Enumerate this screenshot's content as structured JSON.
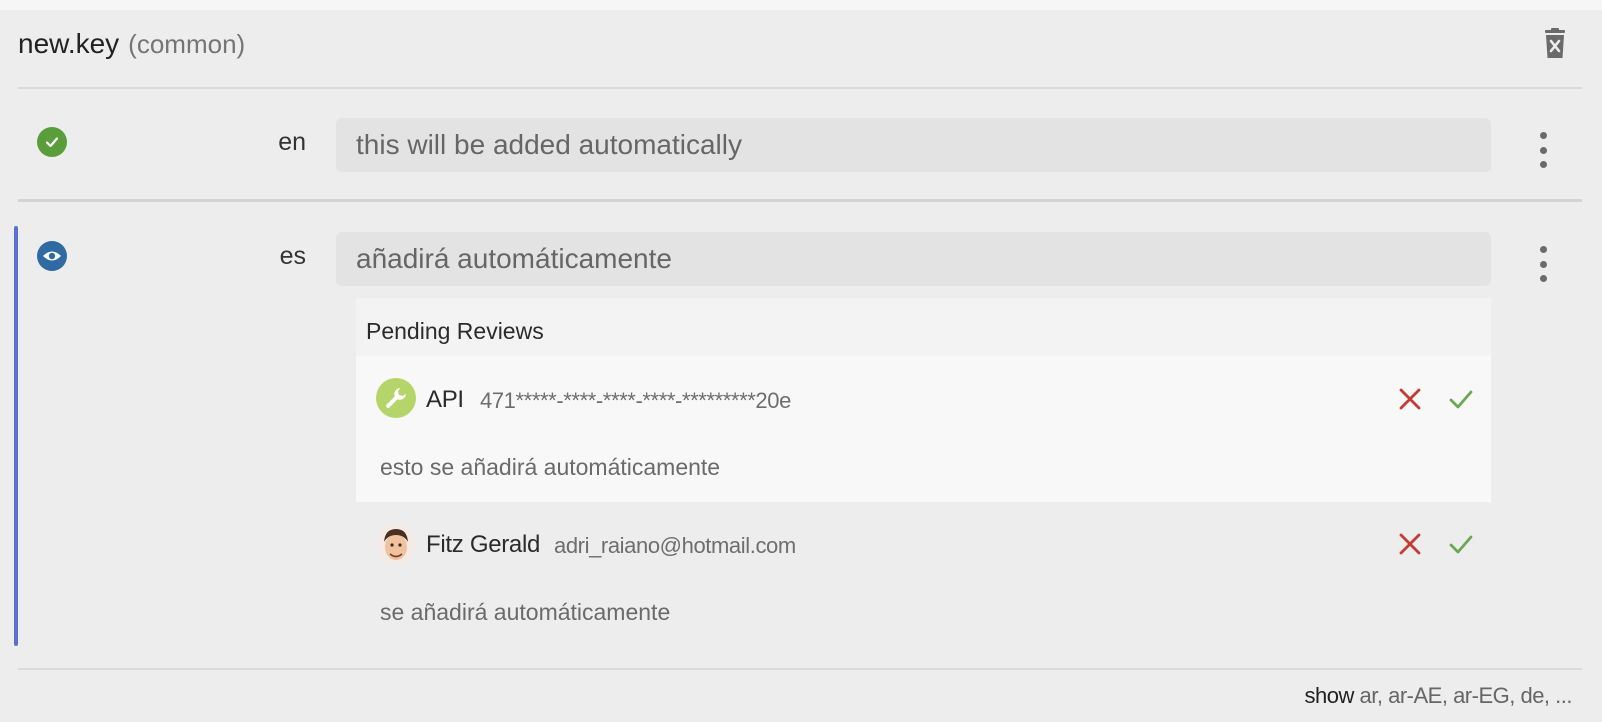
{
  "key": {
    "name": "new.key",
    "namespace": "(common)"
  },
  "icons": {
    "delete": "trash-x-icon",
    "translated": "check-circle-icon",
    "review": "eye-circle-icon",
    "more": "more-vert-icon"
  },
  "colors": {
    "accent": "#5b6fd4",
    "ok": "#5a9e3b",
    "review": "#2f6aa3",
    "reject": "#c53a33",
    "approve": "#6aa84f"
  },
  "translations": [
    {
      "lang": "en",
      "status": "translated",
      "value": "this will be added automatically"
    },
    {
      "lang": "es",
      "status": "in-review",
      "value": "añadirá automáticamente"
    }
  ],
  "pending_reviews": {
    "title": "Pending Reviews",
    "items": [
      {
        "author": "API",
        "author_detail": "471*****-****-****-****-*********20e",
        "text": "esto se añadirá automáticamente",
        "avatar": "wrench-icon"
      },
      {
        "author": "Fitz Gerald",
        "author_detail": "adri_raiano@hotmail.com",
        "text": "se añadirá automáticamente",
        "avatar": "user-avatar"
      }
    ]
  },
  "show_more": {
    "label": "show",
    "languages": "ar, ar-AE, ar-EG, de, ..."
  }
}
